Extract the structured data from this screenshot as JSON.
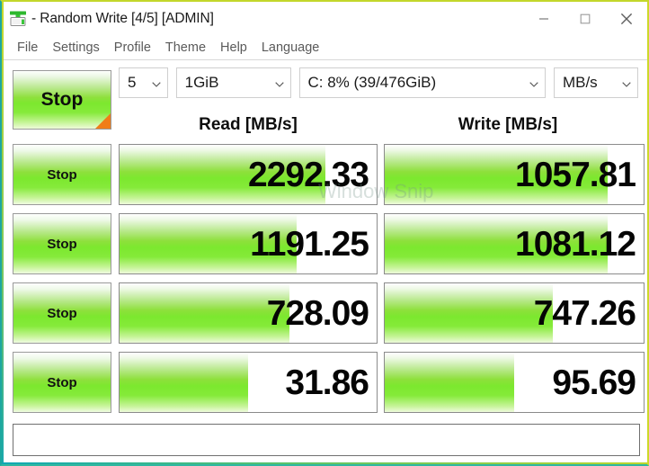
{
  "window": {
    "app_icon": "crystaldiskmark-icon",
    "title": "- Random Write [4/5] [ADMIN]",
    "controls": {
      "minimize": "minimize-icon",
      "maximize": "maximize-icon",
      "close": "close-icon"
    },
    "border_color_top": "#c9d92b",
    "border_color_bottom": "#1ca7a0"
  },
  "menu": {
    "items": [
      {
        "label": "File"
      },
      {
        "label": "Settings"
      },
      {
        "label": "Profile"
      },
      {
        "label": "Theme"
      },
      {
        "label": "Help"
      },
      {
        "label": "Language"
      }
    ]
  },
  "toolbar": {
    "stop_button": "Stop",
    "test_count": "5",
    "test_size": "1GiB",
    "drive": "C: 8% (39/476GiB)",
    "unit": "MB/s",
    "chevron": "⌄"
  },
  "results": {
    "headers": {
      "read": "Read [MB/s]",
      "write": "Write [MB/s]"
    },
    "stop_label": "Stop",
    "rows": [
      {
        "stop": "Stop",
        "read": "2292.33",
        "read_fill": 80,
        "write": "1057.81",
        "write_fill": 86
      },
      {
        "stop": "Stop",
        "read": "1191.25",
        "read_fill": 69,
        "write": "1081.12",
        "write_fill": 86
      },
      {
        "stop": "Stop",
        "read": "728.09",
        "read_fill": 66,
        "write": "747.26",
        "write_fill": 65
      },
      {
        "stop": "Stop",
        "read": "31.86",
        "read_fill": 50,
        "write": "95.69",
        "write_fill": 50
      }
    ]
  },
  "status": {
    "message": ""
  },
  "overlay": {
    "watermark": "Window Snip"
  },
  "colors": {
    "accent_green": "#7ce82e",
    "stop_corner_orange": "#f07d18",
    "text": "#0d0d0d"
  }
}
